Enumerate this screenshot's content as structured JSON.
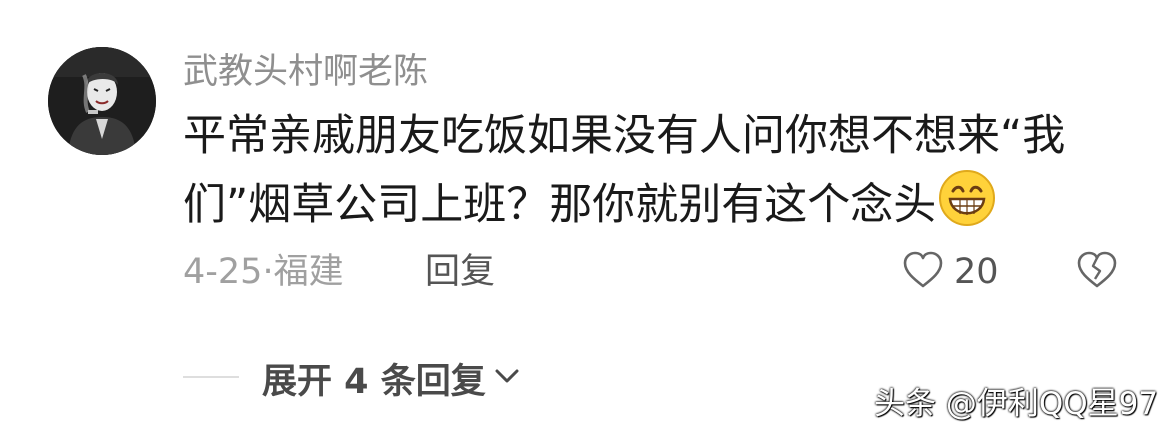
{
  "comment": {
    "username": "武教头村啊老陈",
    "text": "平常亲戚朋友吃饭如果没有人问你想不想来“我们”烟草公司上班？那你就别有这个念头",
    "emoji_icon": "grinning-face-icon",
    "date": "4-25",
    "separator": "·",
    "location": "福建",
    "reply_label": "回复",
    "like_count": "20"
  },
  "replies": {
    "expand_label": "展开 4 条回复"
  },
  "watermark": {
    "text": "头条 @伊利QQ星97"
  },
  "icons": {
    "like": "heart-outline-icon",
    "dislike": "broken-heart-icon",
    "expand": "chevron-down-icon"
  }
}
